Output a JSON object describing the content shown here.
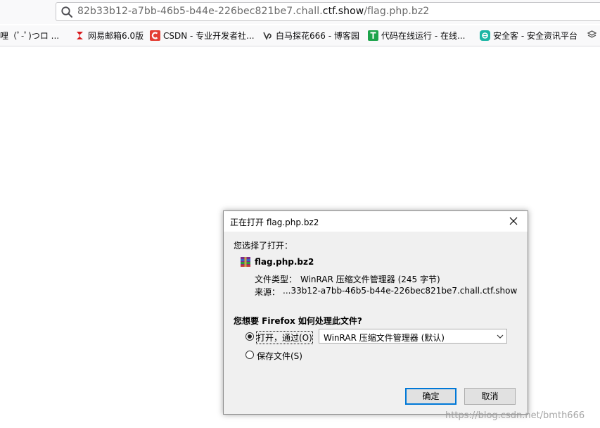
{
  "browser": {
    "url_prefix": "82b33b12-a7bb-46b5-b44e-226bec821be7.chall.",
    "url_domain": "ctf.show",
    "url_path": "/flag.php.bz2",
    "bookmarks": [
      {
        "label": "哩（ﾟ-ﾟ)つロ ...",
        "icon": "none",
        "color": ""
      },
      {
        "label": "网易邮箱6.0版",
        "icon": "netease-mail-icon",
        "color": "#d8191c"
      },
      {
        "label": "CSDN - 专业开发者社...",
        "icon": "csdn-icon",
        "color": "#e33e33"
      },
      {
        "label": "白马探花666 - 博客园",
        "icon": "cnblogs-icon",
        "color": "#333333"
      },
      {
        "label": "代码在线运行 - 在线...",
        "icon": "code-runner-icon",
        "color": "#1ca34a"
      },
      {
        "label": "安全客 - 安全资讯平台",
        "icon": "anquanke-icon",
        "color": "#1bb5a4"
      },
      {
        "label": "",
        "icon": "layers-icon",
        "color": "#555555"
      }
    ]
  },
  "dialog": {
    "title": "正在打开 flag.php.bz2",
    "intro": "您选择了打开：",
    "filename": "flag.php.bz2",
    "type_label": "文件类型：",
    "type_value": "WinRAR 压缩文件管理器 (245 字节)",
    "source_label": "来源：",
    "source_value": "...33b12-a7bb-46b5-b44e-226bec821be7.chall.ctf.show",
    "question": "您想要 Firefox 如何处理此文件?",
    "open_with_label": "打开，通过(O)",
    "open_with_selected": "WinRAR 压缩文件管理器 (默认)",
    "save_label": "保存文件(S)",
    "ok_label": "确定",
    "cancel_label": "取消"
  },
  "watermark": "https://blog.csdn.net/bmth666",
  "colors": {
    "accent": "#0078d7",
    "dialog_bg": "#f0f0f0"
  }
}
